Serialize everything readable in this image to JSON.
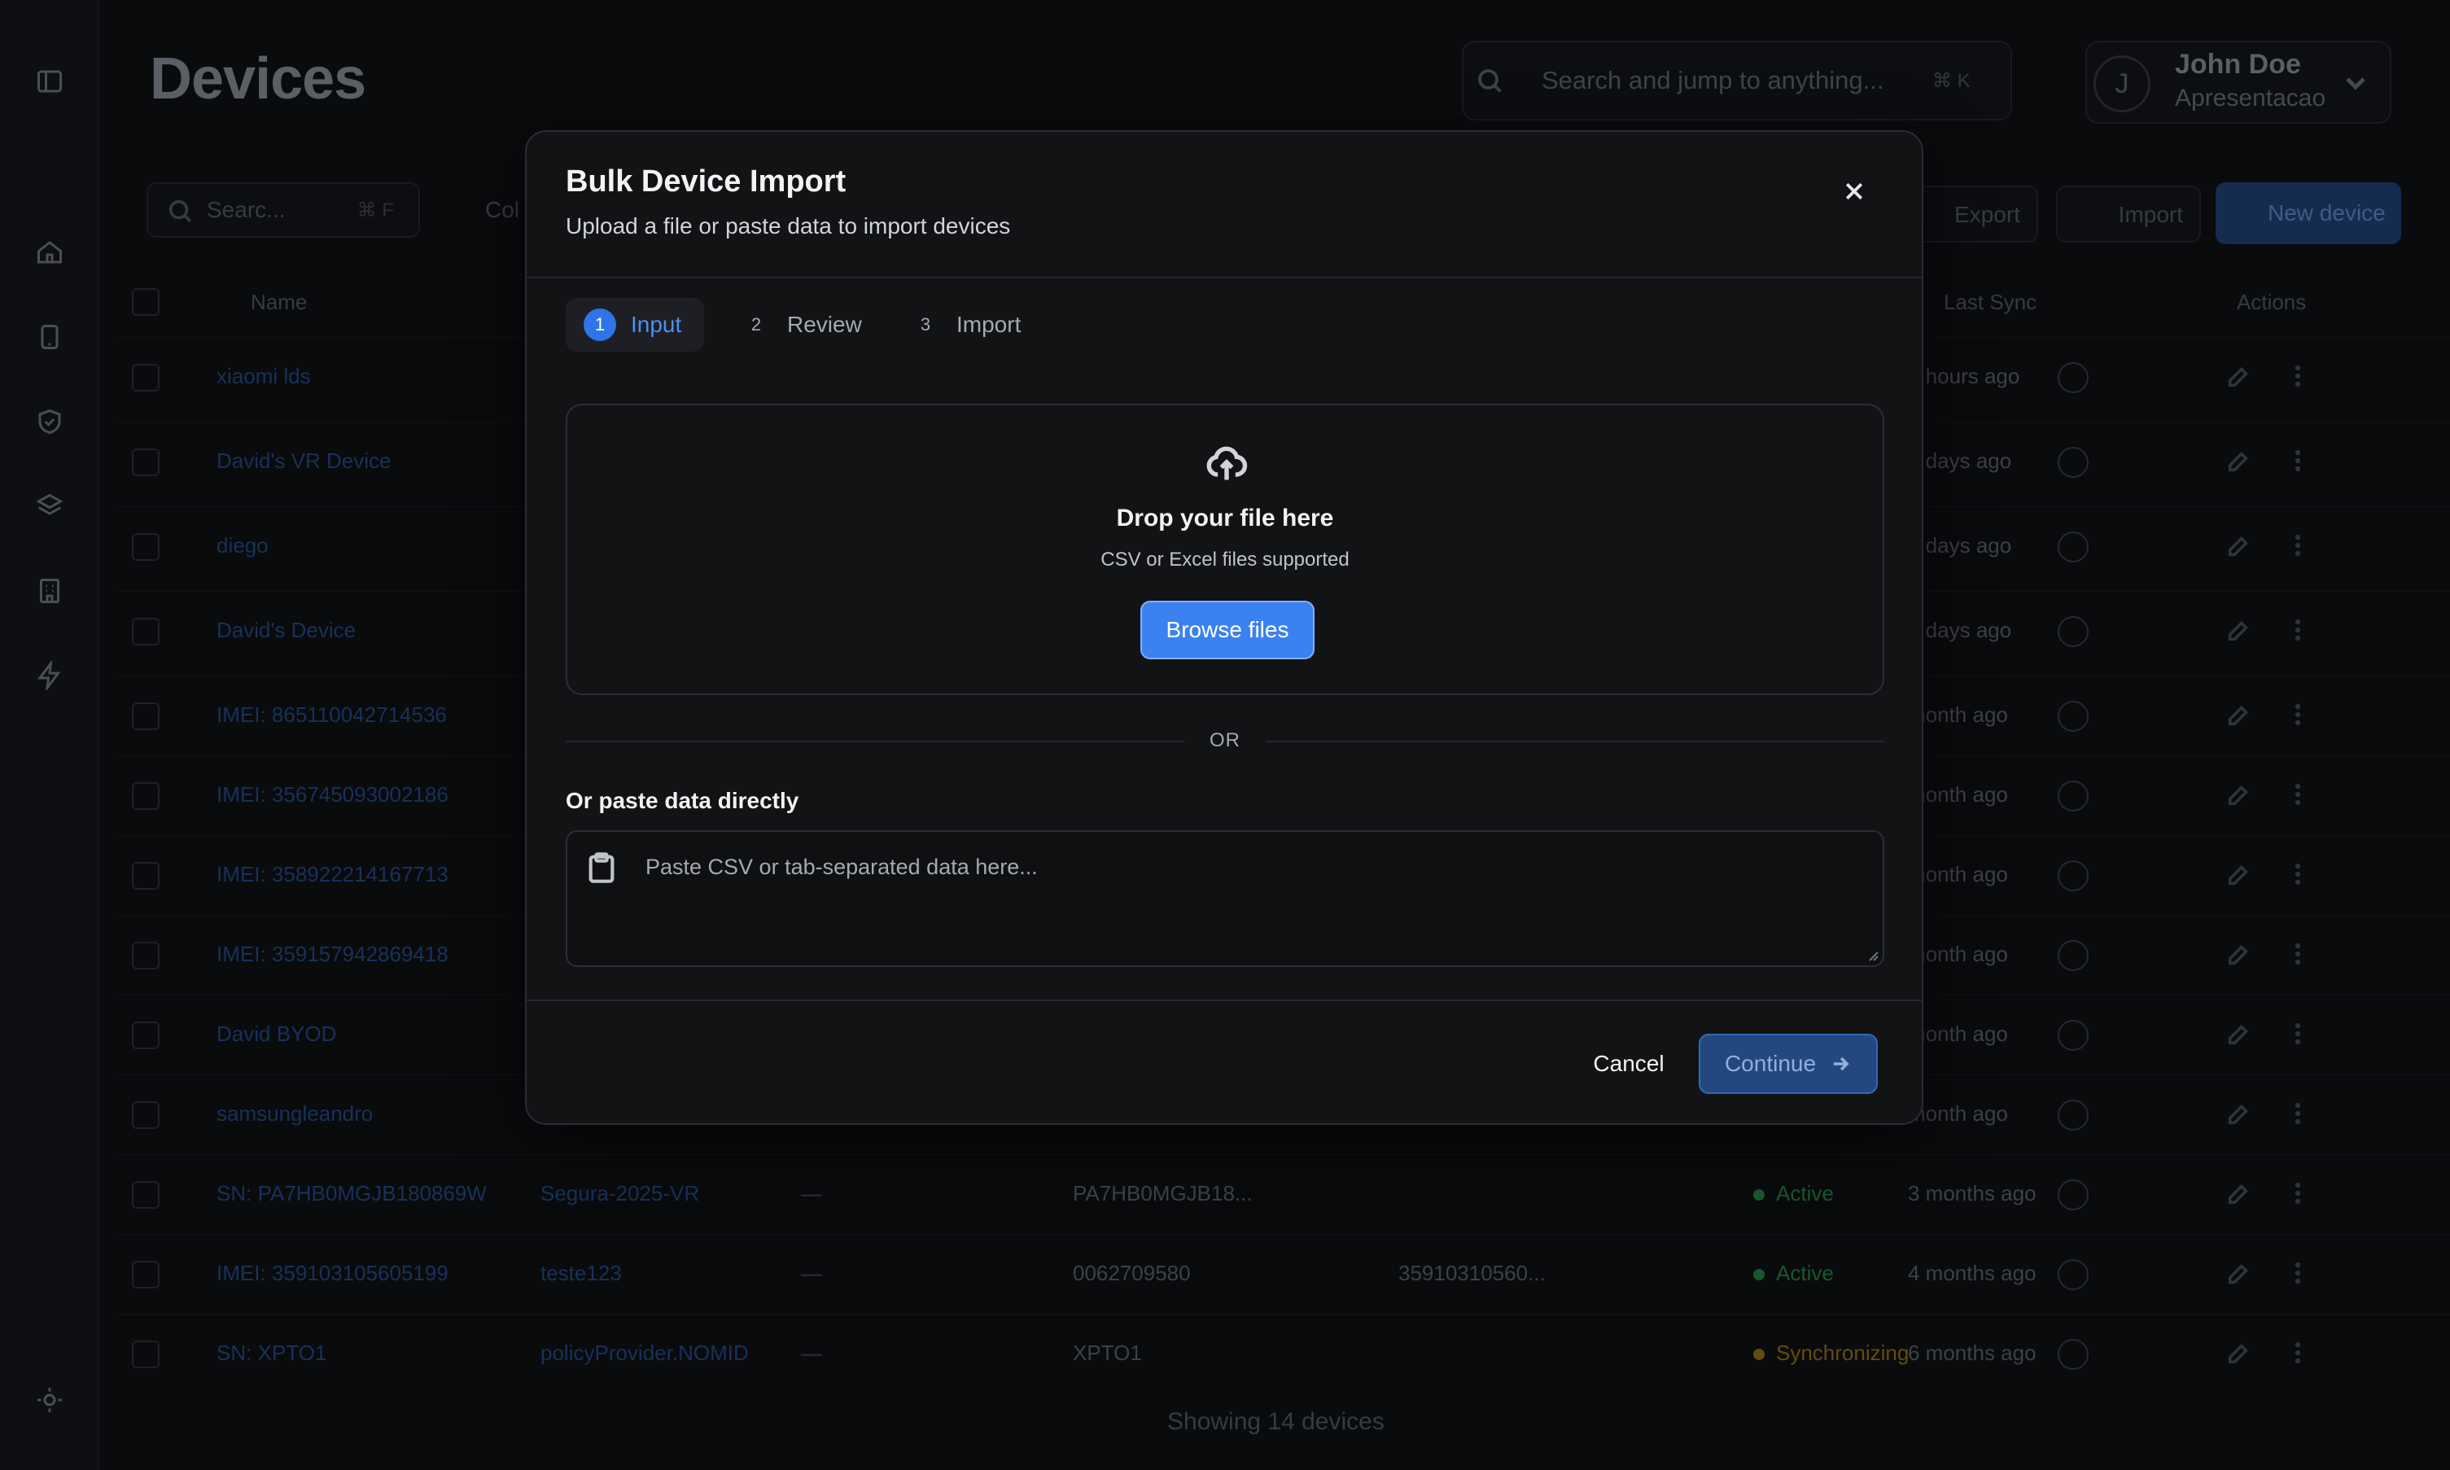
{
  "app": {
    "page_title": "Devices",
    "search": {
      "placeholder": "Search and jump to anything...",
      "shortcut": "⌘ K"
    },
    "user": {
      "initial": "J",
      "name": "John Doe",
      "org": "Apresentacao"
    }
  },
  "toolbar": {
    "search_placeholder": "Searc...",
    "search_shortcut": "⌘ F",
    "columns_label": "Col",
    "export_label": "Export",
    "import_label": "Import",
    "new_device_label": "New device"
  },
  "table": {
    "headers": {
      "name": "Name",
      "last_sync": "Last Sync",
      "actions": "Actions"
    },
    "rows": [
      {
        "name": "xiaomi lds",
        "c2": "",
        "c3": "",
        "c4": "",
        "c5": "",
        "status": "",
        "sync": "1 hours ago"
      },
      {
        "name": "David's VR Device",
        "c2": "",
        "c3": "",
        "c4": "",
        "c5": "",
        "status": "",
        "sync": "3 days ago"
      },
      {
        "name": "diego",
        "c2": "",
        "c3": "",
        "c4": "",
        "c5": "",
        "status": "",
        "sync": "4 days ago"
      },
      {
        "name": "David's Device",
        "c2": "",
        "c3": "",
        "c4": "",
        "c5": "",
        "status": "",
        "sync": "0 days ago"
      },
      {
        "name": "IMEI: 865110042714536",
        "c2": "",
        "c3": "",
        "c4": "",
        "c5": "",
        "status": "",
        "sync": "month ago"
      },
      {
        "name": "IMEI: 356745093002186",
        "c2": "",
        "c3": "",
        "c4": "",
        "c5": "",
        "status": "",
        "sync": "month ago"
      },
      {
        "name": "IMEI: 358922214167713",
        "c2": "",
        "c3": "",
        "c4": "",
        "c5": "",
        "status": "",
        "sync": "month ago"
      },
      {
        "name": "IMEI: 359157942869418",
        "c2": "",
        "c3": "",
        "c4": "",
        "c5": "",
        "status": "",
        "sync": "month ago"
      },
      {
        "name": "David BYOD",
        "c2": "",
        "c3": "",
        "c4": "",
        "c5": "",
        "status": "",
        "sync": "month ago"
      },
      {
        "name": "samsungleandro",
        "c2": "",
        "c3": "",
        "c4": "",
        "c5": "",
        "status": "",
        "sync": "month ago"
      },
      {
        "name": "SN: PA7HB0MGJB180869W",
        "c2": "Segura-2025-VR",
        "c3": "—",
        "c4": "PA7HB0MGJB18...",
        "c5": "",
        "status": "Active",
        "sync": "3 months ago"
      },
      {
        "name": "IMEI: 359103105605199",
        "c2": "teste123",
        "c3": "—",
        "c4": "0062709580",
        "c5": "35910310560...",
        "status": "Active",
        "sync": "4 months ago"
      },
      {
        "name": "SN: XPTO1",
        "c2": "policyProvider.NOMID",
        "c3": "—",
        "c4": "XPTO1",
        "c5": "",
        "status": "Synchronizing",
        "sync": "6 months ago"
      }
    ],
    "footer": "Showing 14 devices"
  },
  "modal": {
    "title": "Bulk Device Import",
    "subtitle": "Upload a file or paste data to import devices",
    "steps": [
      {
        "num": "1",
        "label": "Input"
      },
      {
        "num": "2",
        "label": "Review"
      },
      {
        "num": "3",
        "label": "Import"
      }
    ],
    "dropzone": {
      "title": "Drop your file here",
      "subtitle": "CSV or Excel files supported",
      "browse_label": "Browse files"
    },
    "or_label": "OR",
    "paste_label": "Or paste data directly",
    "paste_placeholder": "Paste CSV or tab-separated data here...",
    "cancel_label": "Cancel",
    "continue_label": "Continue"
  },
  "colors": {
    "accent": "#3b82f0",
    "active_status": "#1f6b3a",
    "sync_status": "#7a5d12"
  }
}
